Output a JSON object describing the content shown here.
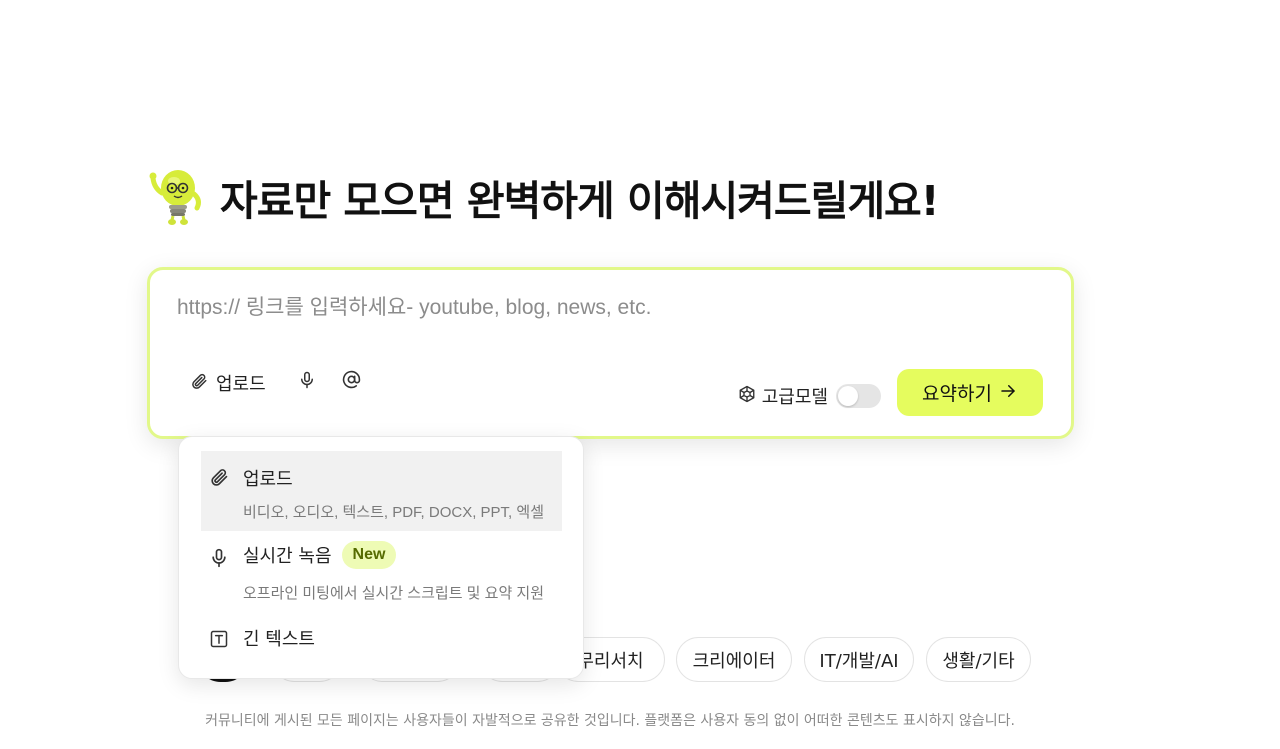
{
  "hero": {
    "title": "자료만 모으면 완벽하게 이해시켜드릴게요!",
    "mascot_icon": "lightbulb-mascot-icon"
  },
  "input": {
    "placeholder": "https:// 링크를 입력하세요- youtube, blog, news, etc.",
    "value": ""
  },
  "toolbar": {
    "upload_label": "업로드",
    "upload_icon": "paperclip-icon",
    "mic_icon": "microphone-icon",
    "mention_icon": "at-sign-icon",
    "advanced_model_label": "고급모델",
    "advanced_model_icon": "cube-icon",
    "advanced_model_enabled": false,
    "submit_label": "요약하기",
    "submit_icon": "arrow-right-icon"
  },
  "dropdown": {
    "items": [
      {
        "title": "업로드",
        "description": "비디오, 오디오, 텍스트, PDF, DOCX, PPT, 엑셀",
        "icon": "paperclip-icon",
        "highlighted": true
      },
      {
        "title": "실시간 녹음",
        "badge": "New",
        "description": "오프라인 미팅에서 실시간 스크립트 및 요약 지원",
        "icon": "microphone-icon"
      },
      {
        "title": "긴 텍스트",
        "icon": "text-box-icon"
      }
    ]
  },
  "categories": {
    "chips": [
      "무리서치",
      "크리에이터",
      "IT/개발/AI",
      "생활/기타"
    ]
  },
  "footer": {
    "text": "커뮤니티에 게시된 모든 페이지는 사용자들이 자발적으로 공유한 것입니다. 플랫폼은 사용자 동의 없이 어떠한 콘텐츠도 표시하지 않습니다."
  },
  "colors": {
    "accent": "#e5fc5e",
    "card_border": "#e2f88a",
    "badge_bg": "#eefbb5",
    "badge_text": "#556b00"
  }
}
